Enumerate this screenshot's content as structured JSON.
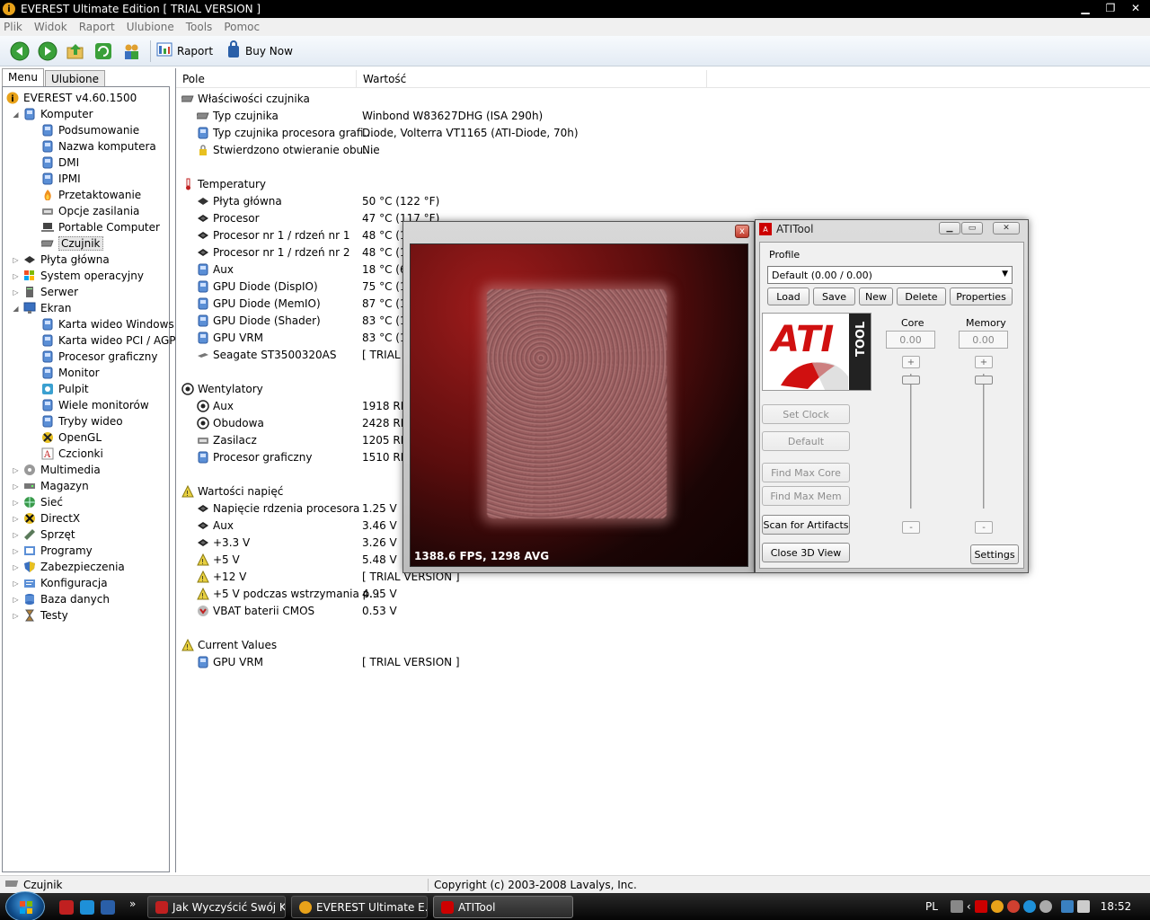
{
  "window": {
    "title": "EVEREST Ultimate Edition  [ TRIAL VERSION ]",
    "app_icon_glyph": "i"
  },
  "menubar": [
    "Plik",
    "Widok",
    "Raport",
    "Ulubione",
    "Tools",
    "Pomoc"
  ],
  "toolbar": {
    "report_label": "Raport",
    "buy_label": "Buy Now"
  },
  "left_tabs": {
    "menu": "Menu",
    "ulubione": "Ulubione"
  },
  "tree": [
    {
      "label": "EVEREST v4.60.1500",
      "level": 0,
      "exp": "",
      "icon": "info-icon"
    },
    {
      "label": "Komputer",
      "level": 1,
      "exp": "◢",
      "icon": "computer-icon"
    },
    {
      "label": "Podsumowanie",
      "level": 2,
      "exp": "",
      "icon": "computer-icon"
    },
    {
      "label": "Nazwa komputera",
      "level": 2,
      "exp": "",
      "icon": "computer-icon"
    },
    {
      "label": "DMI",
      "level": 2,
      "exp": "",
      "icon": "computer-icon"
    },
    {
      "label": "IPMI",
      "level": 2,
      "exp": "",
      "icon": "computer-icon"
    },
    {
      "label": "Przetaktowanie",
      "level": 2,
      "exp": "",
      "icon": "flame-icon"
    },
    {
      "label": "Opcje zasilania",
      "level": 2,
      "exp": "",
      "icon": "power-icon"
    },
    {
      "label": "Portable Computer",
      "level": 2,
      "exp": "",
      "icon": "laptop-icon"
    },
    {
      "label": "Czujnik",
      "level": 2,
      "exp": "",
      "icon": "sensor-icon",
      "selected": true
    },
    {
      "label": "Płyta główna",
      "level": 1,
      "exp": "▷",
      "icon": "chip-icon"
    },
    {
      "label": "System operacyjny",
      "level": 1,
      "exp": "▷",
      "icon": "windows-icon"
    },
    {
      "label": "Serwer",
      "level": 1,
      "exp": "▷",
      "icon": "server-icon"
    },
    {
      "label": "Ekran",
      "level": 1,
      "exp": "◢",
      "icon": "monitor-icon"
    },
    {
      "label": "Karta wideo Windows",
      "level": 2,
      "exp": "",
      "icon": "computer-icon"
    },
    {
      "label": "Karta wideo PCI / AGP",
      "level": 2,
      "exp": "",
      "icon": "computer-icon"
    },
    {
      "label": "Procesor graficzny",
      "level": 2,
      "exp": "",
      "icon": "computer-icon"
    },
    {
      "label": "Monitor",
      "level": 2,
      "exp": "",
      "icon": "computer-icon"
    },
    {
      "label": "Pulpit",
      "level": 2,
      "exp": "",
      "icon": "desktop-icon"
    },
    {
      "label": "Wiele monitorów",
      "level": 2,
      "exp": "",
      "icon": "computer-icon"
    },
    {
      "label": "Tryby wideo",
      "level": 2,
      "exp": "",
      "icon": "computer-icon"
    },
    {
      "label": "OpenGL",
      "level": 2,
      "exp": "",
      "icon": "opengl-icon"
    },
    {
      "label": "Czcionki",
      "level": 2,
      "exp": "",
      "icon": "font-icon"
    },
    {
      "label": "Multimedia",
      "level": 1,
      "exp": "▷",
      "icon": "multimedia-icon"
    },
    {
      "label": "Magazyn",
      "level": 1,
      "exp": "▷",
      "icon": "storage-icon"
    },
    {
      "label": "Sieć",
      "level": 1,
      "exp": "▷",
      "icon": "network-icon"
    },
    {
      "label": "DirectX",
      "level": 1,
      "exp": "▷",
      "icon": "directx-icon"
    },
    {
      "label": "Sprzęt",
      "level": 1,
      "exp": "▷",
      "icon": "hardware-icon"
    },
    {
      "label": "Programy",
      "level": 1,
      "exp": "▷",
      "icon": "programs-icon"
    },
    {
      "label": "Zabezpieczenia",
      "level": 1,
      "exp": "▷",
      "icon": "shield-icon"
    },
    {
      "label": "Konfiguracja",
      "level": 1,
      "exp": "▷",
      "icon": "config-icon"
    },
    {
      "label": "Baza danych",
      "level": 1,
      "exp": "▷",
      "icon": "database-icon"
    },
    {
      "label": "Testy",
      "level": 1,
      "exp": "▷",
      "icon": "hourglass-icon"
    }
  ],
  "list": {
    "col_field": "Pole",
    "col_value": "Wartość",
    "rows": [
      {
        "field": "Właściwości czujnika",
        "value": "",
        "group": true,
        "icon": "sensor-icon"
      },
      {
        "field": "Typ czujnika",
        "value": "Winbond W83627DHG  (ISA 290h)",
        "icon": "sensor-icon"
      },
      {
        "field": "Typ czujnika procesora grafi...",
        "value": "Diode, Volterra VT1165  (ATI-Diode, 70h)",
        "icon": "computer-icon"
      },
      {
        "field": "Stwierdzono otwieranie obu...",
        "value": "Nie",
        "icon": "lock-icon"
      },
      {
        "field": "",
        "value": "",
        "spacer": true
      },
      {
        "field": "Temperatury",
        "value": "",
        "group": true,
        "icon": "thermometer-icon"
      },
      {
        "field": "Płyta główna",
        "value": "50 °C  (122 °F)",
        "icon": "chip-icon"
      },
      {
        "field": "Procesor",
        "value": "47 °C  (117 °F)",
        "icon": "cpu-icon"
      },
      {
        "field": "Procesor nr 1 / rdzeń nr 1",
        "value": "48 °C  (1",
        "icon": "cpu-icon"
      },
      {
        "field": "Procesor nr 1 / rdzeń nr 2",
        "value": "48 °C  (1",
        "icon": "cpu-icon"
      },
      {
        "field": "Aux",
        "value": "18 °C  (6",
        "icon": "computer-icon"
      },
      {
        "field": "GPU Diode (DispIO)",
        "value": "75 °C  (1",
        "icon": "computer-icon"
      },
      {
        "field": "GPU Diode (MemIO)",
        "value": "87 °C  (1",
        "icon": "computer-icon"
      },
      {
        "field": "GPU Diode (Shader)",
        "value": "83 °C  (1",
        "icon": "computer-icon"
      },
      {
        "field": "GPU VRM",
        "value": "83 °C  (1",
        "icon": "computer-icon"
      },
      {
        "field": "Seagate ST3500320AS",
        "value": "[ TRIAL V",
        "icon": "disk-icon"
      },
      {
        "field": "",
        "value": "",
        "spacer": true
      },
      {
        "field": "Wentylatory",
        "value": "",
        "group": true,
        "icon": "fan-icon"
      },
      {
        "field": "Aux",
        "value": "1918 RPM",
        "icon": "fan-icon"
      },
      {
        "field": "Obudowa",
        "value": "2428 RPM",
        "icon": "fan-icon"
      },
      {
        "field": "Zasilacz",
        "value": "1205 RPM",
        "icon": "power-icon"
      },
      {
        "field": "Procesor graficzny",
        "value": "1510 RPM",
        "icon": "computer-icon"
      },
      {
        "field": "",
        "value": "",
        "spacer": true
      },
      {
        "field": "Wartości napięć",
        "value": "",
        "group": true,
        "icon": "voltage-icon"
      },
      {
        "field": "Napięcie rdzenia procesora",
        "value": "1.25 V",
        "icon": "cpu-icon"
      },
      {
        "field": "Aux",
        "value": "3.46 V",
        "icon": "cpu-icon"
      },
      {
        "field": "+3.3 V",
        "value": "3.26 V",
        "icon": "cpu-icon"
      },
      {
        "field": "+5 V",
        "value": "5.48 V",
        "icon": "voltage-icon"
      },
      {
        "field": "+12 V",
        "value": "[ TRIAL VERSION ]",
        "icon": "voltage-icon"
      },
      {
        "field": "+5 V podczas wstrzymania p...",
        "value": "4.95 V",
        "icon": "voltage-icon"
      },
      {
        "field": "VBAT baterii CMOS",
        "value": "0.53 V",
        "icon": "battery-icon"
      },
      {
        "field": "",
        "value": "",
        "spacer": true
      },
      {
        "field": "Current Values",
        "value": "",
        "group": true,
        "icon": "voltage-icon"
      },
      {
        "field": "GPU VRM",
        "value": "[ TRIAL VERSION ]",
        "icon": "computer-icon"
      }
    ]
  },
  "statusbar": {
    "left": "Czujnik",
    "right": "Copyright (c) 2003-2008 Lavalys, Inc."
  },
  "view3d": {
    "fps_text": "1388.6 FPS, 1298 AVG",
    "close_glyph": "x"
  },
  "atitool": {
    "title": "ATITool",
    "profile_label": "Profile",
    "profile_value": "Default (0.00 / 0.00)",
    "load": "Load",
    "save": "Save",
    "new": "New",
    "delete": "Delete",
    "properties": "Properties",
    "core_label": "Core",
    "memory_label": "Memory",
    "core_value": "0.00",
    "memory_value": "0.00",
    "set_clock": "Set Clock",
    "default": "Default",
    "find_max_core": "Find Max Core",
    "find_max_mem": "Find Max Mem",
    "scan_artifacts": "Scan for Artifacts",
    "close_3d": "Close 3D View",
    "settings": "Settings",
    "plus": "+",
    "minus": "-",
    "logo_main": "ATI",
    "logo_side": "TOOL"
  },
  "taskbar": {
    "tasks": [
      {
        "label": "Jak Wyczyścić Swój K...",
        "active": false
      },
      {
        "label": "EVEREST Ultimate E...",
        "active": false
      },
      {
        "label": "ATITool",
        "active": true
      }
    ],
    "language": "PL",
    "clock": "18:52",
    "overflow": "»"
  },
  "colors": {
    "accent": "#1e6bbf",
    "render_bg": "#5a0d0d"
  }
}
